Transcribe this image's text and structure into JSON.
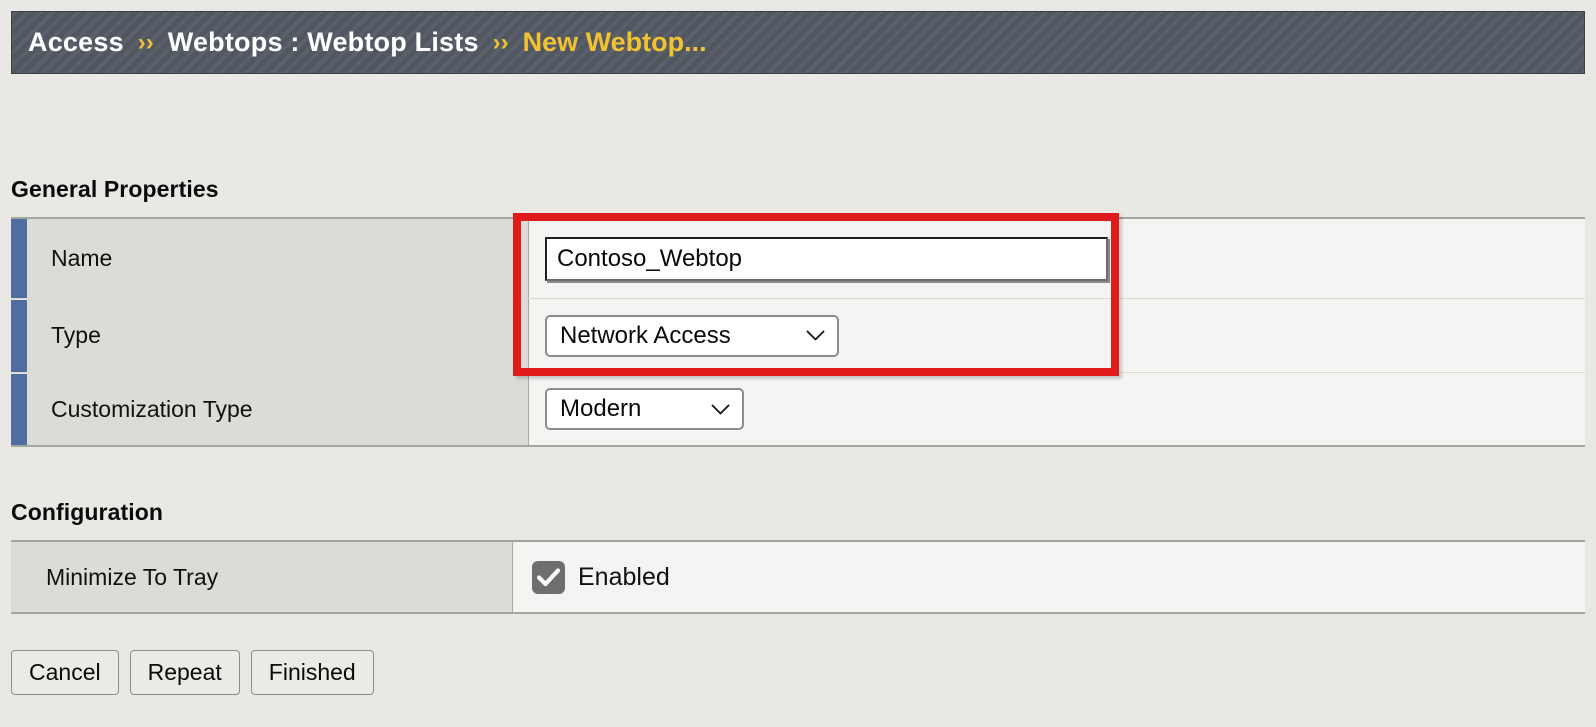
{
  "breadcrumb": {
    "root": "Access",
    "separator": "››",
    "section": "Webtops : Webtop Lists",
    "current": "New Webtop..."
  },
  "general_properties": {
    "title": "General Properties",
    "rows": [
      {
        "label": "Name",
        "control": "text",
        "value": "Contoso_Webtop"
      },
      {
        "label": "Type",
        "control": "select",
        "value": "Network Access"
      },
      {
        "label": "Customization Type",
        "control": "select",
        "value": "Modern"
      }
    ]
  },
  "configuration": {
    "title": "Configuration",
    "rows": [
      {
        "label": "Minimize To Tray",
        "control": "checkbox",
        "value": "Enabled",
        "checked": true
      }
    ]
  },
  "buttons": {
    "cancel": "Cancel",
    "repeat": "Repeat",
    "finished": "Finished"
  },
  "icons": {
    "chevron_down": "chevron-down-icon",
    "check": "check-icon"
  },
  "colors": {
    "header_bg": "#535a64",
    "breadcrumb_highlight": "#f2c230",
    "row_accent": "#4d6e9e",
    "annotation": "#e01b1b",
    "page_bg": "#e9e8e4",
    "label_cell_bg": "#dcdbd7",
    "value_cell_bg": "#f5f4f2",
    "checkbox_bg": "#6e6e6e"
  }
}
